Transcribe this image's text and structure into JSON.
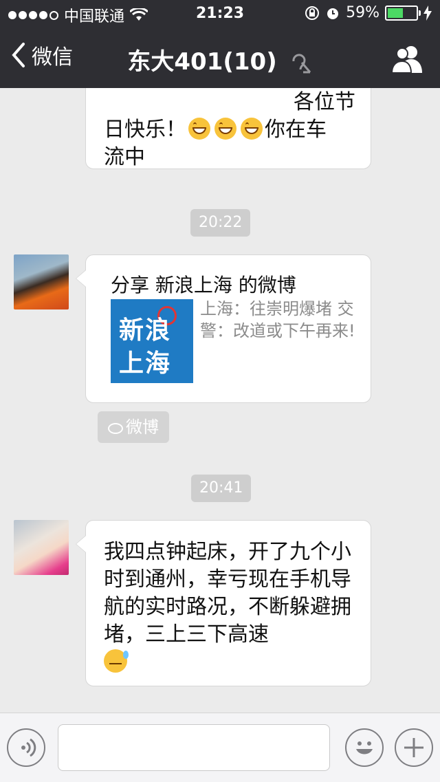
{
  "status_bar": {
    "carrier": "中国联通",
    "time": "21:23",
    "battery": "59%",
    "battery_level": 0.59
  },
  "nav": {
    "back_label": "微信",
    "title": "东大401(10)"
  },
  "messages": [
    {
      "text_lines": [
        "各位节",
        "日快乐！",
        "你在车",
        "流中"
      ]
    },
    {
      "timestamp": "20:22",
      "share_title": "分享 新浪上海 的微博",
      "logo_text": [
        "新浪",
        "上海"
      ],
      "description": "上海：往崇明爆堵 交警：改道或下午再来!",
      "source_label": "微博"
    },
    {
      "timestamp": "20:41",
      "text": "我四点钟起床，开了九个小时到通州，幸亏现在手机导航的实时路况，不断躲避拥堵，三上三下高速"
    }
  ],
  "input": {
    "value": "",
    "placeholder": ""
  },
  "colors": {
    "bar_bg": "#2e2e33",
    "chat_bg": "#ebebeb",
    "battery_green": "#4cd964",
    "weibo_blue": "#1f7bc4"
  },
  "icons": [
    "wifi-icon",
    "lock-rotation-icon",
    "alarm-icon",
    "charging-icon",
    "mute-icon",
    "group-members-icon",
    "voice-icon",
    "emoji-icon",
    "plus-icon",
    "weibo-icon"
  ]
}
